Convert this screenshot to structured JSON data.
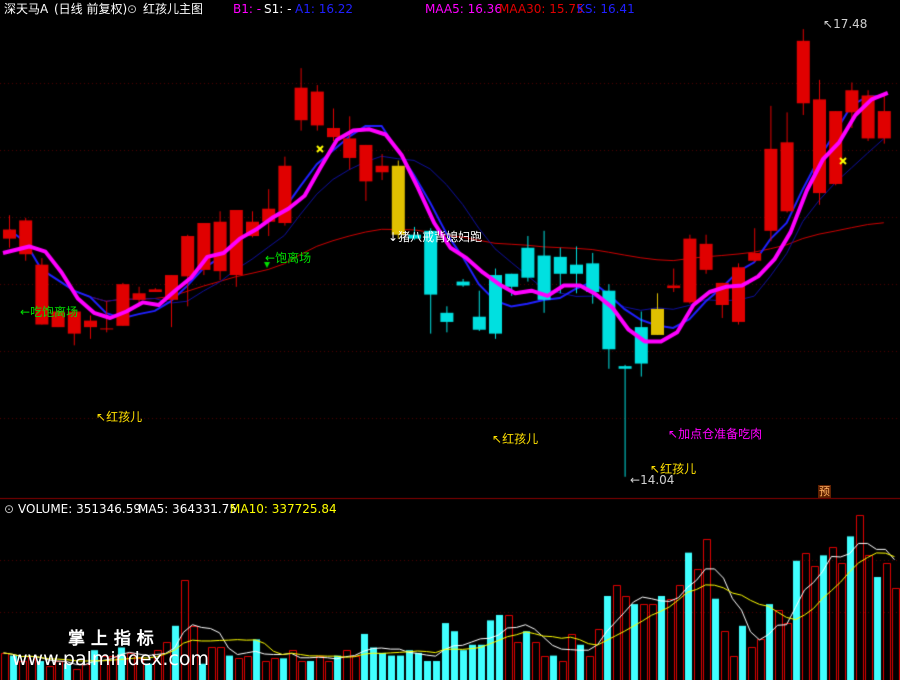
{
  "header": {
    "stock_name": "深天马A",
    "period": "(日线 前复权)",
    "indicator_name": "红孩儿主图",
    "b1": "B1: -",
    "s1": "S1: -",
    "a1": "A1: 16.22",
    "maa5": "MAA5: 16.36",
    "maa30": "MAA30: 15.75",
    "ks": "KS: 16.41"
  },
  "volume_header": {
    "volume": "VOLUME: 351346.59",
    "ma5": "MA5: 364331.75",
    "ma10": "MA10: 337725.84"
  },
  "annotations": {
    "high_price": "17.48",
    "low_price": "14.04",
    "chi_bao_1": "吃饱离场",
    "chi_bao_2": "饱离场",
    "hong_hai_er": "红孩儿",
    "zhu_ba_jie": "猪八戒背媳妇跑",
    "jia_dian_cang": "加点仓准备吃肉",
    "yu_badge": "预"
  },
  "watermark": {
    "cn": "掌 上 指 标",
    "url": "www.palmindex.com"
  },
  "colors": {
    "up": "#e00000",
    "down": "#00e0e0",
    "warn": "#e0c000",
    "maa5": "#ff00ff",
    "maa30": "#d00000",
    "line_blue1": "#2020ff",
    "line_blue2": "#1010a0",
    "ma5": "#ffffff",
    "ma10": "#ffff00"
  },
  "candles": [
    {
      "o": 15.87,
      "c": 15.94,
      "h": 16.05,
      "l": 15.8,
      "t": "up"
    },
    {
      "o": 16.01,
      "c": 15.75,
      "h": 16.03,
      "l": 15.7,
      "t": "up"
    },
    {
      "o": 15.67,
      "c": 15.21,
      "h": 15.72,
      "l": 15.21,
      "t": "up"
    },
    {
      "o": 15.19,
      "c": 15.31,
      "h": 15.32,
      "l": 15.19,
      "t": "up"
    },
    {
      "o": 15.31,
      "c": 15.14,
      "h": 15.33,
      "l": 15.05,
      "t": "up"
    },
    {
      "o": 15.24,
      "c": 15.19,
      "h": 15.28,
      "l": 15.1,
      "t": "up"
    },
    {
      "o": 15.18,
      "c": 15.18,
      "h": 15.39,
      "l": 15.15,
      "t": "up"
    },
    {
      "o": 15.2,
      "c": 15.52,
      "h": 15.53,
      "l": 15.2,
      "t": "up"
    },
    {
      "o": 15.45,
      "c": 15.4,
      "h": 15.5,
      "l": 15.35,
      "t": "up"
    },
    {
      "o": 15.48,
      "c": 15.46,
      "h": 15.49,
      "l": 15.46,
      "t": "up"
    },
    {
      "o": 15.4,
      "c": 15.59,
      "h": 15.59,
      "l": 15.19,
      "t": "up"
    },
    {
      "o": 15.58,
      "c": 15.89,
      "h": 15.9,
      "l": 15.35,
      "t": "up"
    },
    {
      "o": 15.63,
      "c": 15.99,
      "h": 15.99,
      "l": 15.59,
      "t": "up"
    },
    {
      "o": 15.62,
      "c": 16.0,
      "h": 16.08,
      "l": 15.55,
      "t": "up"
    },
    {
      "o": 15.59,
      "c": 16.09,
      "h": 16.09,
      "l": 15.5,
      "t": "up"
    },
    {
      "o": 15.89,
      "c": 16.0,
      "h": 16.08,
      "l": 15.88,
      "t": "up"
    },
    {
      "o": 16.0,
      "c": 16.1,
      "h": 16.25,
      "l": 15.89,
      "t": "up"
    },
    {
      "o": 15.99,
      "c": 16.43,
      "h": 16.5,
      "l": 15.97,
      "t": "up"
    },
    {
      "o": 16.78,
      "c": 17.03,
      "h": 17.18,
      "l": 16.7,
      "t": "up"
    },
    {
      "o": 16.74,
      "c": 17.0,
      "h": 17.05,
      "l": 16.7,
      "t": "up"
    },
    {
      "o": 16.65,
      "c": 16.72,
      "h": 16.87,
      "l": 16.62,
      "t": "up"
    },
    {
      "o": 16.49,
      "c": 16.64,
      "h": 16.81,
      "l": 16.4,
      "t": "up"
    },
    {
      "o": 16.31,
      "c": 16.59,
      "h": 16.59,
      "l": 16.16,
      "t": "up"
    },
    {
      "o": 16.38,
      "c": 16.43,
      "h": 16.52,
      "l": 16.32,
      "t": "up"
    },
    {
      "o": 16.43,
      "c": 15.9,
      "h": 16.47,
      "l": 15.87,
      "t": "warn"
    },
    {
      "o": 15.9,
      "c": 15.87,
      "h": 15.96,
      "l": 15.86,
      "t": "down"
    },
    {
      "o": 15.93,
      "c": 15.44,
      "h": 15.95,
      "l": 15.14,
      "t": "down"
    },
    {
      "o": 15.3,
      "c": 15.23,
      "h": 15.35,
      "l": 15.15,
      "t": "down"
    },
    {
      "o": 15.54,
      "c": 15.51,
      "h": 15.56,
      "l": 15.5,
      "t": "down"
    },
    {
      "o": 15.27,
      "c": 15.17,
      "h": 15.47,
      "l": 15.16,
      "t": "down"
    },
    {
      "o": 15.59,
      "c": 15.14,
      "h": 15.64,
      "l": 15.1,
      "t": "down"
    },
    {
      "o": 15.5,
      "c": 15.6,
      "h": 15.6,
      "l": 15.43,
      "t": "down"
    },
    {
      "o": 15.8,
      "c": 15.57,
      "h": 15.89,
      "l": 15.54,
      "t": "down"
    },
    {
      "o": 15.74,
      "c": 15.4,
      "h": 15.93,
      "l": 15.3,
      "t": "down"
    },
    {
      "o": 15.73,
      "c": 15.6,
      "h": 15.8,
      "l": 15.45,
      "t": "down"
    },
    {
      "o": 15.67,
      "c": 15.6,
      "h": 15.81,
      "l": 15.45,
      "t": "down"
    },
    {
      "o": 15.68,
      "c": 15.46,
      "h": 15.76,
      "l": 15.37,
      "t": "down"
    },
    {
      "o": 15.47,
      "c": 15.02,
      "h": 15.52,
      "l": 14.87,
      "t": "down"
    },
    {
      "o": 14.87,
      "c": 14.89,
      "h": 14.9,
      "l": 14.04,
      "t": "down"
    },
    {
      "o": 15.19,
      "c": 14.91,
      "h": 15.31,
      "l": 14.81,
      "t": "down"
    },
    {
      "o": 15.13,
      "c": 15.33,
      "h": 15.45,
      "l": 15.13,
      "t": "warn"
    },
    {
      "o": 15.51,
      "c": 15.49,
      "h": 15.64,
      "l": 15.46,
      "t": "up"
    },
    {
      "o": 15.38,
      "c": 15.87,
      "h": 15.9,
      "l": 15.37,
      "t": "up"
    },
    {
      "o": 15.63,
      "c": 15.83,
      "h": 15.9,
      "l": 15.6,
      "t": "up"
    },
    {
      "o": 15.36,
      "c": 15.53,
      "h": 15.53,
      "l": 15.26,
      "t": "up"
    },
    {
      "o": 15.23,
      "c": 15.65,
      "h": 15.68,
      "l": 15.21,
      "t": "up"
    },
    {
      "o": 15.7,
      "c": 15.76,
      "h": 15.95,
      "l": 15.69,
      "t": "up"
    },
    {
      "o": 15.93,
      "c": 16.56,
      "h": 16.89,
      "l": 15.85,
      "t": "up"
    },
    {
      "o": 16.08,
      "c": 16.61,
      "h": 16.84,
      "l": 16.07,
      "t": "up"
    },
    {
      "o": 16.91,
      "c": 17.39,
      "h": 17.48,
      "l": 16.82,
      "t": "up"
    },
    {
      "o": 16.22,
      "c": 16.94,
      "h": 17.09,
      "l": 16.13,
      "t": "up"
    },
    {
      "o": 16.29,
      "c": 16.85,
      "h": 16.85,
      "l": 16.28,
      "t": "up"
    },
    {
      "o": 16.84,
      "c": 17.01,
      "h": 17.07,
      "l": 16.72,
      "t": "up"
    },
    {
      "o": 16.64,
      "c": 16.97,
      "h": 17.01,
      "l": 16.62,
      "t": "up"
    },
    {
      "o": 16.85,
      "c": 16.64,
      "h": 16.99,
      "l": 16.6,
      "t": "up"
    }
  ],
  "maa5_line": [
    15.76,
    15.81,
    15.77,
    15.61,
    15.41,
    15.3,
    15.26,
    15.31,
    15.38,
    15.36,
    15.47,
    15.57,
    15.73,
    15.76,
    15.87,
    15.94,
    16.03,
    16.1,
    16.2,
    16.42,
    16.63,
    16.7,
    16.71,
    16.67,
    16.51,
    16.26,
    15.99,
    15.8,
    15.72,
    15.61,
    15.52,
    15.45,
    15.47,
    15.43,
    15.51,
    15.51,
    15.44,
    15.34,
    15.17,
    15.08,
    15.08,
    15.15,
    15.36,
    15.46,
    15.5,
    15.51,
    15.58,
    15.71,
    15.92,
    16.24,
    16.48,
    16.61,
    16.82,
    16.94,
    16.99
  ],
  "volumes": [
    0.1,
    0.09,
    0.07,
    0.09,
    0.07,
    0.05,
    0.07,
    0.06,
    0.04,
    0.06,
    0.11,
    0.09,
    0.09,
    0.12,
    0.1,
    0.08,
    0.06,
    0.11,
    0.14,
    0.2,
    0.37,
    0.2,
    0.06,
    0.12,
    0.12,
    0.09,
    0.08,
    0.09,
    0.15,
    0.07,
    0.08,
    0.08,
    0.11,
    0.07,
    0.07,
    0.09,
    0.07,
    0.09,
    0.11,
    0.09,
    0.17,
    0.12,
    0.1,
    0.09,
    0.09,
    0.11,
    0.1,
    0.07,
    0.07,
    0.21,
    0.18,
    0.11,
    0.13,
    0.13,
    0.22,
    0.24,
    0.24,
    0.14,
    0.18,
    0.14,
    0.09,
    0.09,
    0.07,
    0.17,
    0.13,
    0.09,
    0.19,
    0.31,
    0.35,
    0.31,
    0.28,
    0.28,
    0.28,
    0.31,
    0.3,
    0.35,
    0.47,
    0.41,
    0.52,
    0.3,
    0.18,
    0.09,
    0.2,
    0.12,
    0.15,
    0.28,
    0.26,
    0.21,
    0.44,
    0.47,
    0.42,
    0.46,
    0.49,
    0.43,
    0.53,
    0.61,
    0.46,
    0.38,
    0.43,
    0.34
  ]
}
